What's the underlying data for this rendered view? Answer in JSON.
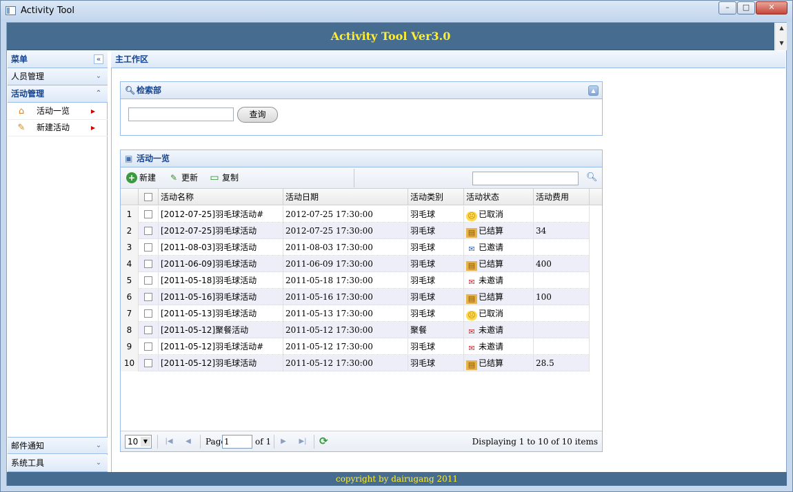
{
  "window": {
    "title": "Activity Tool",
    "min": "–",
    "max": "□",
    "close": "✕"
  },
  "header": {
    "title": "Activity Tool Ver3.0"
  },
  "sidebar": {
    "title": "菜单",
    "sections": [
      {
        "label": "人员管理"
      },
      {
        "label": "活动管理",
        "items": [
          {
            "label": "活动一览"
          },
          {
            "label": "新建活动"
          }
        ]
      },
      {
        "label": "邮件通知"
      },
      {
        "label": "系统工具"
      }
    ]
  },
  "main": {
    "title": "主工作区"
  },
  "search_panel": {
    "title": "检索部",
    "input_value": "",
    "button": "查询"
  },
  "grid": {
    "title": "活动一览",
    "toolbar": {
      "new": "新建",
      "edit": "更新",
      "copy": "复制",
      "filter_value": ""
    },
    "columns": [
      "活动名称",
      "活动日期",
      "活动类别",
      "活动状态",
      "活动费用"
    ],
    "rows": [
      {
        "no": "1",
        "name": "[2012-07-25]羽毛球活动#",
        "date": "2012-07-25 17:30:00",
        "type": "羽毛球",
        "status": "已取消",
        "status_icon": "sad-face-icon",
        "fee": ""
      },
      {
        "no": "2",
        "name": "[2012-07-25]羽毛球活动",
        "date": "2012-07-25 17:30:00",
        "type": "羽毛球",
        "status": "已结算",
        "status_icon": "coins-icon",
        "fee": "34"
      },
      {
        "no": "3",
        "name": "[2011-08-03]羽毛球活动",
        "date": "2011-08-03 17:30:00",
        "type": "羽毛球",
        "status": "已邀请",
        "status_icon": "invite-icon",
        "fee": ""
      },
      {
        "no": "4",
        "name": "[2011-06-09]羽毛球活动",
        "date": "2011-06-09 17:30:00",
        "type": "羽毛球",
        "status": "已结算",
        "status_icon": "coins-icon",
        "fee": "400"
      },
      {
        "no": "5",
        "name": "[2011-05-18]羽毛球活动",
        "date": "2011-05-18 17:30:00",
        "type": "羽毛球",
        "status": "未邀请",
        "status_icon": "mail-x-icon",
        "fee": ""
      },
      {
        "no": "6",
        "name": "[2011-05-16]羽毛球活动",
        "date": "2011-05-16 17:30:00",
        "type": "羽毛球",
        "status": "已结算",
        "status_icon": "coins-icon",
        "fee": "100"
      },
      {
        "no": "7",
        "name": "[2011-05-13]羽毛球活动",
        "date": "2011-05-13 17:30:00",
        "type": "羽毛球",
        "status": "已取消",
        "status_icon": "sad-face-icon",
        "fee": ""
      },
      {
        "no": "8",
        "name": "[2011-05-12]聚餐活动",
        "date": "2011-05-12 17:30:00",
        "type": "聚餐",
        "status": "未邀请",
        "status_icon": "mail-x-icon",
        "fee": ""
      },
      {
        "no": "9",
        "name": "[2011-05-12]羽毛球活动#",
        "date": "2011-05-12 17:30:00",
        "type": "羽毛球",
        "status": "未邀请",
        "status_icon": "mail-x-icon",
        "fee": ""
      },
      {
        "no": "10",
        "name": "[2011-05-12]羽毛球活动",
        "date": "2011-05-12 17:30:00",
        "type": "羽毛球",
        "status": "已结算",
        "status_icon": "coins-icon",
        "fee": "28.5"
      }
    ]
  },
  "pager": {
    "page_size": "10",
    "page_label": "Page",
    "page_value": "1",
    "of_label": "of 1",
    "info": "Displaying 1 to 10 of 10 items"
  },
  "footer": {
    "text": "copyright by dairugang 2011"
  },
  "colors": {
    "header_bg": "#466c90",
    "header_text": "#ffee33",
    "panel_border": "#99bbe8",
    "title_blue": "#15428b"
  }
}
